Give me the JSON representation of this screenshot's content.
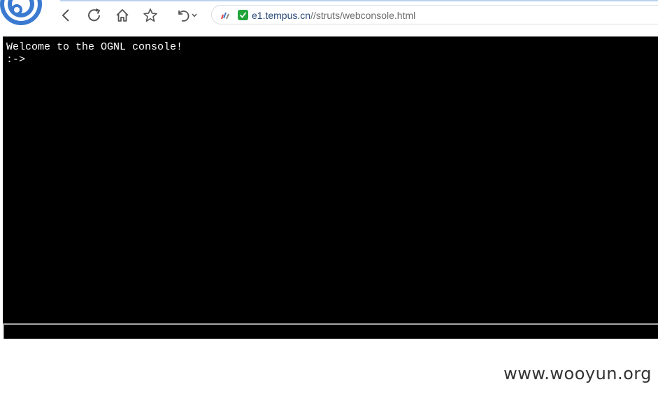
{
  "browser": {
    "address": {
      "host": "e1.tempus.cn",
      "path": "//struts/webconsole.html"
    },
    "icons": {
      "logo": "browser-logo-icon",
      "back": "chevron-left-icon",
      "refresh": "refresh-icon",
      "home": "home-icon",
      "favorite": "star-icon",
      "undo": "undo-icon",
      "undo_menu": "chevron-down-icon",
      "site": "site-favicon-icon",
      "secure": "check-shield-icon"
    }
  },
  "console": {
    "welcome": "Welcome to the OGNL console!",
    "prompt": ":->",
    "input_value": ""
  },
  "watermark": "www.wooyun.org",
  "colors": {
    "console_bg": "#000000",
    "console_text": "#ffffff",
    "secure_badge": "#22a53a",
    "url_host": "#2a4a7a"
  }
}
